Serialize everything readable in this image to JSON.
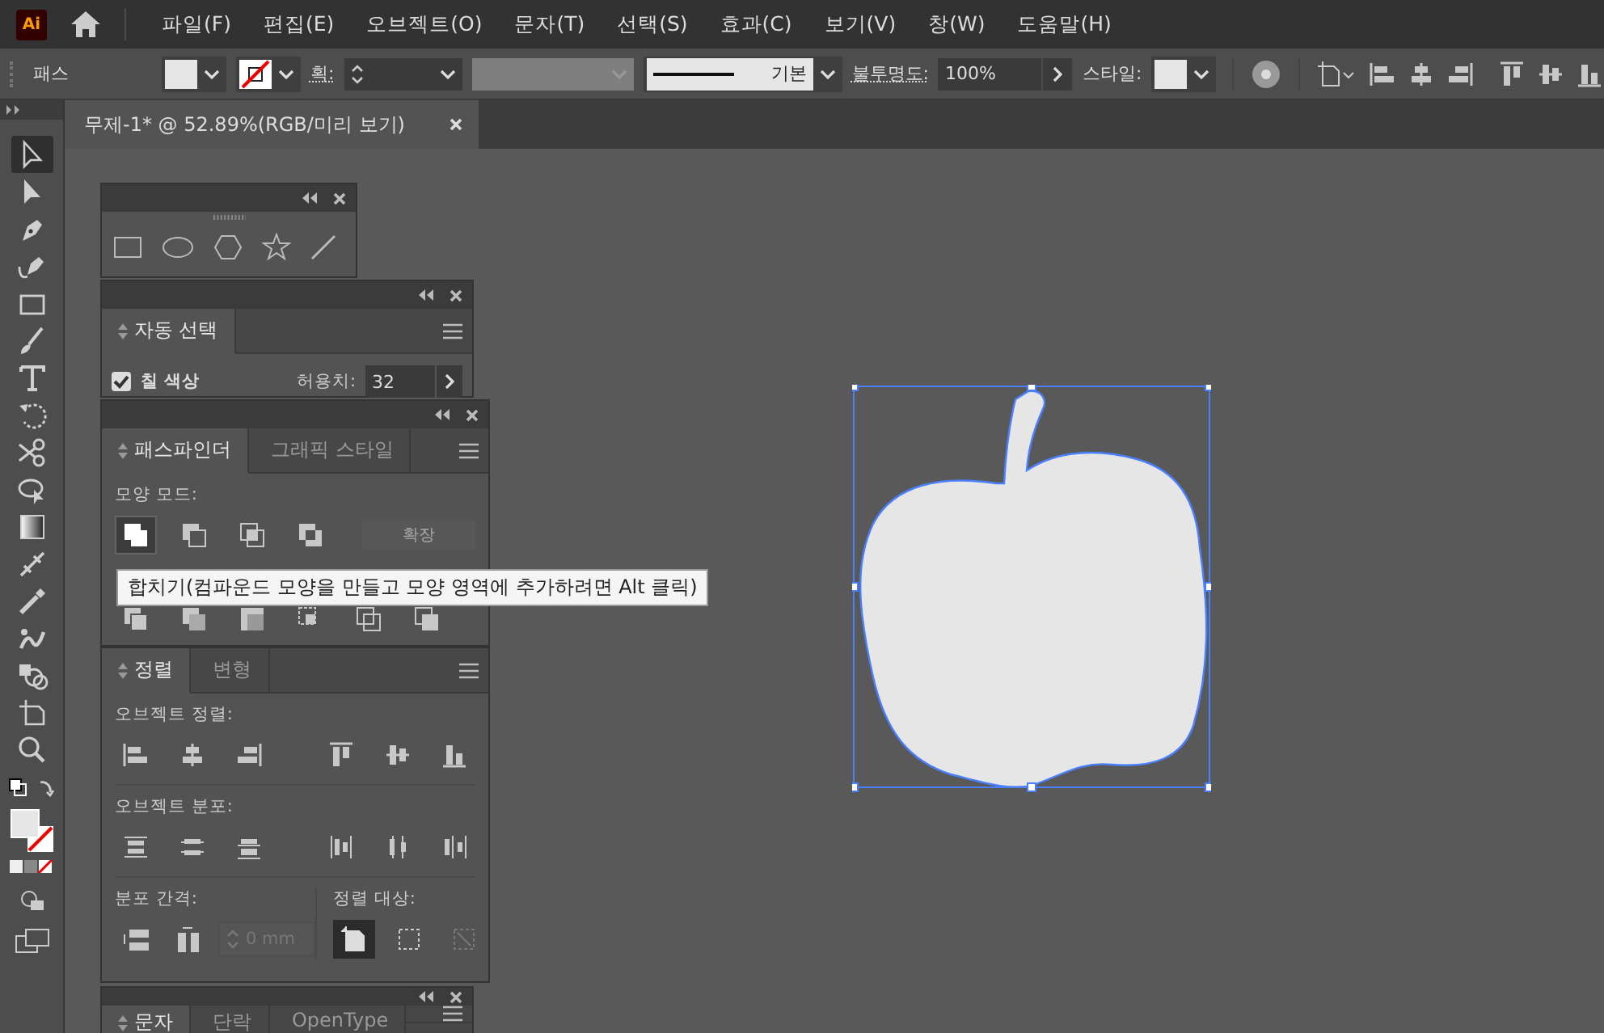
{
  "app_logo": "Ai",
  "menu_bar": {
    "items": [
      "파일(F)",
      "편집(E)",
      "오브젝트(O)",
      "문자(T)",
      "선택(S)",
      "효과(C)",
      "보기(V)",
      "창(W)",
      "도움말(H)"
    ]
  },
  "control_bar": {
    "selection_label": "패스",
    "stroke_label": "획:",
    "stroke_profile": "기본",
    "opacity_label": "불투명도:",
    "opacity_value": "100%",
    "style_label": "스타일:"
  },
  "document_tabs": [
    {
      "title": "무제-1* @ 52.89%(RGB/미리 보기)",
      "selected": true
    }
  ],
  "tools": [
    {
      "kind": "selection",
      "selected": true
    },
    {
      "kind": "direct",
      "selected": false
    },
    {
      "kind": "pen",
      "selected": false
    },
    {
      "kind": "curvature",
      "selected": false
    },
    {
      "kind": "rectangle",
      "selected": false
    },
    {
      "kind": "brush",
      "selected": false
    },
    {
      "kind": "type",
      "selected": false
    },
    {
      "kind": "rotate",
      "selected": false
    },
    {
      "kind": "scissors",
      "selected": false
    },
    {
      "kind": "lasso",
      "selected": false
    },
    {
      "kind": "gradient",
      "selected": false
    },
    {
      "kind": "width",
      "selected": false
    },
    {
      "kind": "eyedropper",
      "selected": false
    },
    {
      "kind": "warp",
      "selected": false
    },
    {
      "kind": "builder",
      "selected": false
    },
    {
      "kind": "artboard",
      "selected": false
    },
    {
      "kind": "zoom",
      "selected": false
    }
  ],
  "auto_select_panel": {
    "tabs": [
      {
        "label": "자동 선택",
        "selected": true
      }
    ],
    "fill_color": {
      "label": "칠 색상",
      "checked": true
    },
    "tolerance_label": "허용치:",
    "tolerance_value": "32"
  },
  "pathfinder_panel": {
    "tabs": [
      {
        "label": "패스파인더",
        "selected": true
      },
      {
        "label": "그래픽 스타일",
        "selected": false
      }
    ],
    "shape_modes_label": "모양 모드:",
    "expand_button": {
      "label": "확장",
      "disabled": true
    }
  },
  "tooltip": "합치기(컴파운드 모양을 만들고 모양 영역에 추가하려면 Alt 클릭)",
  "align_panel": {
    "tabs": [
      {
        "label": "정렬",
        "selected": true
      },
      {
        "label": "변형",
        "selected": false
      }
    ],
    "align_objects_label": "오브젝트 정렬:",
    "distribute_objects_label": "오브젝트 분포:",
    "distribute_spacing_label": "분포 간격:",
    "spacing_field": {
      "value": "0 mm",
      "disabled": true
    },
    "align_to_label": "정렬 대상:"
  },
  "type_panel": {
    "tabs": [
      {
        "label": "문자",
        "selected": true
      },
      {
        "label": "단락",
        "selected": false
      },
      {
        "label": "OpenType",
        "selected": false
      }
    ]
  }
}
